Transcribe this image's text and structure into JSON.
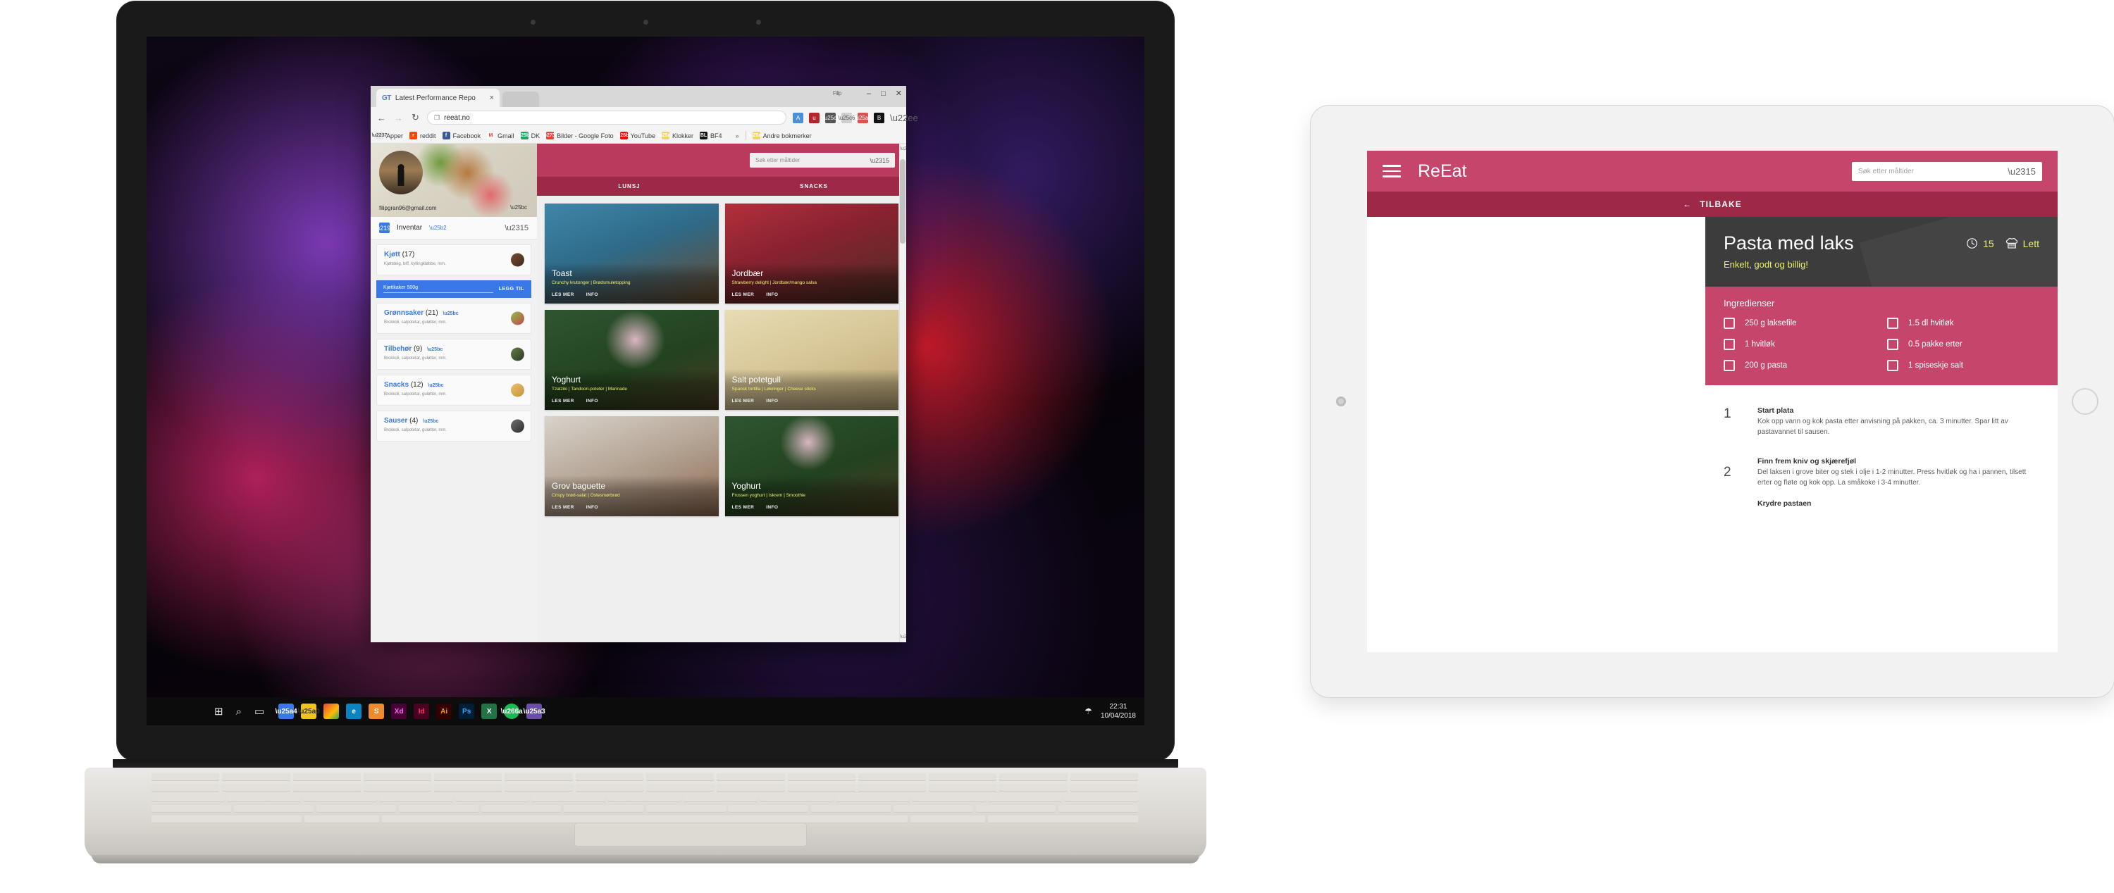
{
  "laptop": {
    "browser": {
      "tab": {
        "favicon": "GT",
        "title": "Latest Performance Repo",
        "close": "×"
      },
      "window_controls": {
        "minimize": "–",
        "maximize": "□",
        "close": "✕"
      },
      "nav": {
        "back": "←",
        "forward": "→",
        "reload": "↻"
      },
      "omnibox": {
        "doc_icon": "❐",
        "url": "reeat.no"
      },
      "bookmarks": [
        {
          "label": "Apper",
          "icon": "apps-grid-icon"
        },
        {
          "label": "reddit",
          "icon": "reddit-icon"
        },
        {
          "label": "Facebook",
          "icon": "facebook-icon"
        },
        {
          "label": "Gmail",
          "icon": "gmail-icon"
        },
        {
          "label": "DK",
          "icon": "drive-icon"
        },
        {
          "label": "Bilder - Google Foto",
          "icon": "photos-icon"
        },
        {
          "label": "YouTube",
          "icon": "youtube-icon"
        },
        {
          "label": "Klokker",
          "icon": "folder-icon"
        },
        {
          "label": "BF4",
          "icon": "battlelog-icon"
        },
        {
          "label": "»",
          "icon": "overflow-icon"
        },
        {
          "label": "Andre bokmerker",
          "icon": "folder-icon"
        }
      ]
    },
    "app": {
      "sidebar": {
        "email": "filipgran96@gmail.com",
        "panel_title": "Inventar",
        "categories": [
          {
            "name": "Kjøtt",
            "count": "(17)",
            "desc": "Kjøttdeig, biff, kyllingkløbbe, mm.",
            "expanded": true
          },
          {
            "name": "Grønnsaker",
            "count": "(21)",
            "desc": "Brokkoli, salpotetar, guløtter, mm.",
            "expanded": false
          },
          {
            "name": "Tilbehør",
            "count": "(9)",
            "desc": "Brokkoli, salpotetar, guløtter, mm.",
            "expanded": false
          },
          {
            "name": "Snacks",
            "count": "(12)",
            "desc": "Brokkoli, salpotetar, guløtter, mm.",
            "expanded": false
          },
          {
            "name": "Sauser",
            "count": "(4)",
            "desc": "Brokkoli, salpotetar, guløtter, mm.",
            "expanded": false
          }
        ],
        "add_row": {
          "value": "Kjøttkaker 500g",
          "button": "LEGG TIL"
        }
      },
      "search_placeholder": "Søk etter måltider",
      "tabs": [
        {
          "label": "LUNSJ"
        },
        {
          "label": "SNACKS"
        }
      ],
      "cards": [
        {
          "title": "Toast",
          "sub": "Crunchy krutonger | Brødsmuletopping",
          "more": "LES MER",
          "info": "INFO"
        },
        {
          "title": "Jordbær",
          "sub": "Strawberry delight | Jordbær/mango salsa",
          "more": "LES MER",
          "info": "INFO"
        },
        {
          "title": "Yoghurt",
          "sub": "Tzatziki | Tandoori-poteter | Marinade",
          "more": "LES MER",
          "info": "INFO"
        },
        {
          "title": "Salt potetgull",
          "sub": "Spansk tortilla | Løkringer | Cheese sticks",
          "more": "LES MER",
          "info": "INFO"
        },
        {
          "title": "Grov baguette",
          "sub": "Crispy brød-salat | Ostesmørbrød",
          "more": "LES MER",
          "info": "INFO"
        },
        {
          "title": "Yoghurt",
          "sub": "Frossen yoghurt | Iskrem | Smoothie",
          "more": "LES MER",
          "info": "INFO"
        }
      ]
    },
    "taskbar": {
      "start": "⊞",
      "search": "⌕",
      "taskview": "▭",
      "apps": [
        "Cortana",
        "File Explorer",
        "Chrome",
        "Edge",
        "Sublime",
        "Xd",
        "Id",
        "Ai",
        "Ps",
        "Excel",
        "Spotify",
        "Store"
      ],
      "tray_icon": "☂",
      "time": "22:31",
      "date": "10/04/2018"
    }
  },
  "tablet": {
    "appbar": {
      "menu": "hamburger-icon",
      "title": "ReEat",
      "search_placeholder": "Søk etter måltider"
    },
    "backbar": {
      "arrow": "←",
      "label": "TILBAKE"
    },
    "recipe": {
      "title": "Pasta med laks",
      "subtitle": "Enkelt, godt og billig!",
      "time": "15",
      "difficulty": "Lett",
      "ingredients_title": "Ingredienser",
      "ingredients": [
        "250 g laksefile",
        "1.5 dl hvitløk",
        "1 hvitløk",
        "0.5 pakke erter",
        "200 g pasta",
        "1 spiseskje salt"
      ],
      "steps": [
        {
          "num": "1",
          "title": "Start plata",
          "text": "Kok opp vann og kok pasta etter anvisning på pakken, ca. 3 minutter. Spar litt av pastavannet til sausen."
        },
        {
          "num": "2",
          "title": "Finn frem kniv og skjærefjøl",
          "text": "Del laksen i grove biter og stek i olje i 1-2 minutter. Press hvitløk og ha i pannen, tilsett erter og fløte og kok opp. La småkoke i 3-4 minutter."
        }
      ],
      "next_step_partial": "Krydre pastaen"
    }
  },
  "colors": {
    "brand_pink": "#c6466b",
    "brand_dark": "#9e2946",
    "accent_blue": "#3b78e7",
    "yellow": "#e9ef6b",
    "hero_dark": "#3c3c3c"
  }
}
